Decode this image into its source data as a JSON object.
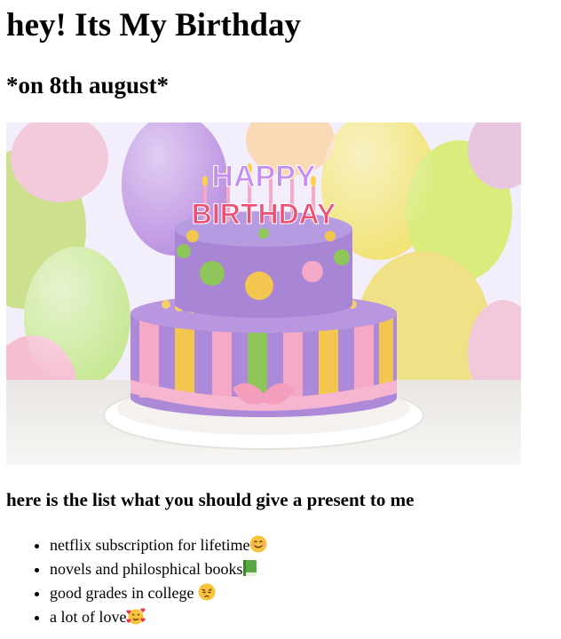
{
  "page": {
    "title": "hey! Its My Birthday",
    "subtitle": "*on 8th august*"
  },
  "image": {
    "cake_text_line1": "HAPPY",
    "cake_text_line2": "BIRTHDAY"
  },
  "list_heading": "here is the list what you should give a present to me",
  "wishlist": [
    {
      "label": "netflix subscription for lifetime",
      "icon": "smiling-face-icon"
    },
    {
      "label": "novels and philosphical books",
      "icon": "green-book-icon"
    },
    {
      "label": "good grades in college ",
      "icon": "pleading-face-icon"
    },
    {
      "label": "a lot of love",
      "icon": "hearts-face-icon"
    }
  ],
  "colors": {
    "purple": "#a583d4",
    "pink": "#f6a9c6",
    "yellow": "#f3c74f",
    "green": "#8fc65a"
  }
}
